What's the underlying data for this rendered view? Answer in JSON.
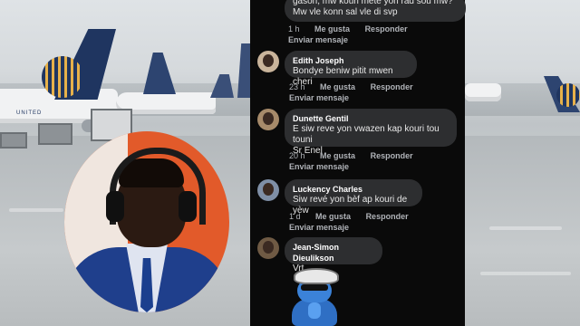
{
  "comments": [
    {
      "name": "",
      "text_line1": "gason, mw kouri mete yon rad sou mw?",
      "text_line2": "Mw vle konn sal vle di svp",
      "time": "1 h",
      "like": "Me gusta",
      "reply": "Responder",
      "send": "Enviar mensaje"
    },
    {
      "name": "Edith Joseph",
      "text_line1": "Bondye beniw pitit mwen cheri",
      "text_line2": "",
      "time": "23 h",
      "like": "Me gusta",
      "reply": "Responder",
      "send": "Enviar mensaje"
    },
    {
      "name": "Dunette Gentil",
      "text_line1": "E siw reve yon vwazen kap kouri tou touni",
      "text_line2": "Sr Enel",
      "time": "20 h",
      "like": "Me gusta",
      "reply": "Responder",
      "send": "Enviar mensaje"
    },
    {
      "name": "Luckency Charles",
      "text_line1": "Siw revé yon bèf ap kouri de yèw",
      "text_line2": "",
      "time": "1 d",
      "like": "Me gusta",
      "reply": "Responder",
      "send": "Enviar mensaje"
    },
    {
      "name": "Jean-Simon Dieulikson",
      "text_line1": "Vrt",
      "text_line2": "",
      "time": "",
      "like": "",
      "reply": "",
      "send": ""
    }
  ],
  "plane_livery_text": "UNITED"
}
